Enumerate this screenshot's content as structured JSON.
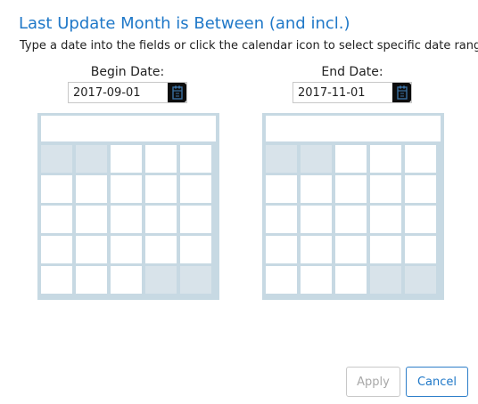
{
  "dialog": {
    "title": "Last Update Month is Between (and incl.)",
    "instructions": "Type a date into the fields or click the calendar icon to select specific date ranges."
  },
  "begin": {
    "label": "Begin Date:",
    "value": "2017-09-01",
    "calendar_icon": "calendar-icon"
  },
  "end": {
    "label": "End Date:",
    "value": "2017-11-01",
    "calendar_icon": "calendar-icon"
  },
  "buttons": {
    "apply_label": "Apply",
    "cancel_label": "Cancel",
    "apply_enabled": false
  },
  "colors": {
    "title": "#1f78c8",
    "calendar_border": "#c7d9e3",
    "calendar_shaded_cell": "#d8e3ea",
    "cancel_border": "#2d7ec9",
    "apply_disabled_text": "#a8a8a8"
  },
  "calendar_placeholders": {
    "begin": {
      "rows": 5,
      "cols": 5,
      "shaded_cells": [
        [
          0,
          0
        ],
        [
          0,
          1
        ],
        [
          4,
          3
        ],
        [
          4,
          4
        ]
      ]
    },
    "end": {
      "rows": 5,
      "cols": 5,
      "shaded_cells": [
        [
          0,
          0
        ],
        [
          0,
          1
        ],
        [
          4,
          3
        ],
        [
          4,
          4
        ]
      ]
    }
  }
}
